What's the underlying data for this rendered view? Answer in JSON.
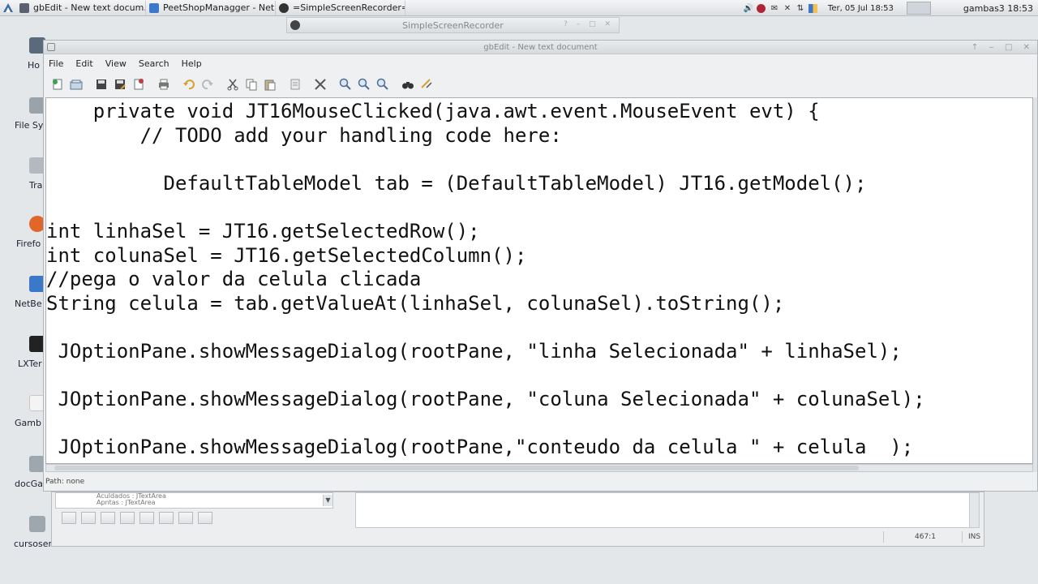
{
  "taskbar": {
    "tasks": [
      {
        "label": "gbEdit - New text docum..."
      },
      {
        "label": "PeetShopManagger - Net..."
      },
      {
        "label": "=SimpleScreenRecorder="
      }
    ],
    "clock": "Ter, 05 Jul  18:53",
    "user": "gambas3 18:53"
  },
  "recorder": {
    "title": "SimpleScreenRecorder"
  },
  "desktop": {
    "icons": [
      {
        "label": "Ho"
      },
      {
        "label": "File Sy"
      },
      {
        "label": "Tra"
      },
      {
        "label": "Firefo"
      },
      {
        "label": "NetBe"
      },
      {
        "label": "LXTer"
      },
      {
        "label": "Gamb"
      },
      {
        "label": "docGa"
      },
      {
        "label": "cursoser"
      }
    ]
  },
  "window": {
    "title": "gbEdit - New text document",
    "menu": [
      "File",
      "Edit",
      "View",
      "Search",
      "Help"
    ],
    "code": [
      "    private void JT16MouseClicked(java.awt.event.MouseEvent evt) {",
      "        // TODO add your handling code here:",
      "",
      "          DefaultTableModel tab = (DefaultTableModel) JT16.getModel();",
      "",
      "int linhaSel = JT16.getSelectedRow();",
      "int colunaSel = JT16.getSelectedColumn();",
      "//pega o valor da celula clicada",
      "String celula = tab.getValueAt(linhaSel, colunaSel).toString();",
      "",
      " JOptionPane.showMessageDialog(rootPane, \"linha Selecionada\" + linhaSel);",
      "",
      " JOptionPane.showMessageDialog(rootPane, \"coluna Selecionada\" + colunaSel);",
      "",
      " JOptionPane.showMessageDialog(rootPane,\"conteudo da celula \" + celula  );"
    ],
    "status": "Path: none"
  },
  "under": {
    "list_rows": [
      "Aculdados : JTextArea",
      "Apntas : JTextArea"
    ],
    "position": "467:1",
    "mode": "INS"
  }
}
